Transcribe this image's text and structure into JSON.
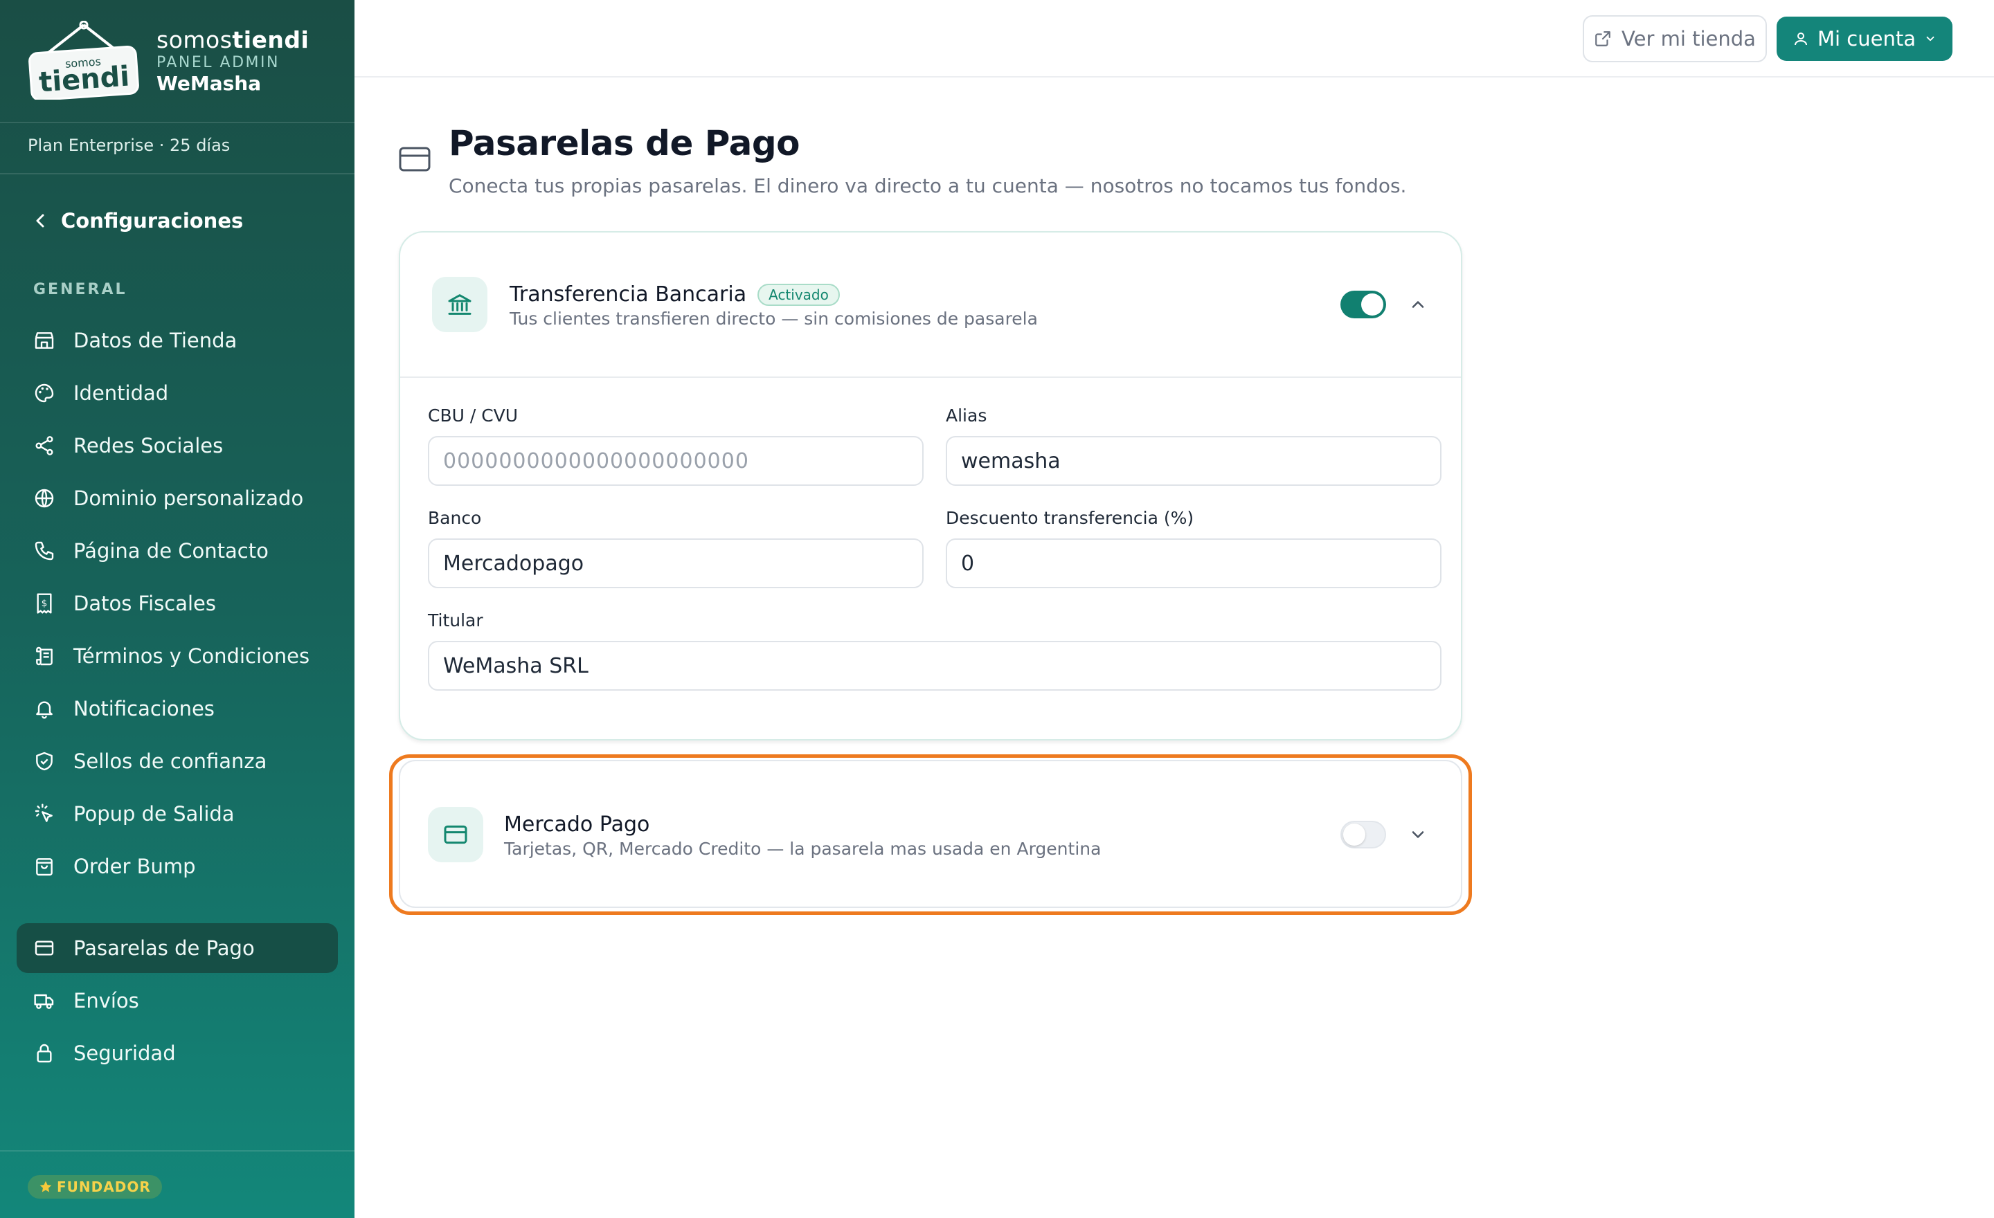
{
  "brand": {
    "logo_small": "somos",
    "logo_big": "tiendi",
    "name_light": "somos",
    "name_bold": "tiendi",
    "panel": "PANEL ADMIN",
    "store": "WeMasha"
  },
  "plan": "Plan Enterprise · 25 días",
  "sidebar": {
    "back_label": "Configuraciones",
    "section_label": "GENERAL",
    "items": [
      {
        "label": "Datos de Tienda",
        "icon": "store-icon"
      },
      {
        "label": "Identidad",
        "icon": "palette-icon"
      },
      {
        "label": "Redes Sociales",
        "icon": "share-icon"
      },
      {
        "label": "Dominio personalizado",
        "icon": "globe-icon"
      },
      {
        "label": "Página de Contacto",
        "icon": "phone-icon"
      },
      {
        "label": "Datos Fiscales",
        "icon": "receipt-icon"
      },
      {
        "label": "Términos y Condiciones",
        "icon": "scroll-icon"
      },
      {
        "label": "Notificaciones",
        "icon": "bell-icon"
      },
      {
        "label": "Sellos de confianza",
        "icon": "shield-check-icon"
      },
      {
        "label": "Popup de Salida",
        "icon": "pointer-click-icon"
      },
      {
        "label": "Order Bump",
        "icon": "bag-icon"
      }
    ],
    "items2": [
      {
        "label": "Pasarelas de Pago",
        "icon": "credit-card-icon",
        "active": true
      },
      {
        "label": "Envíos",
        "icon": "truck-icon"
      },
      {
        "label": "Seguridad",
        "icon": "lock-icon"
      }
    ],
    "badge": "FUNDADOR"
  },
  "topbar": {
    "store_button": "Ver mi tienda",
    "account_button": "Mi cuenta"
  },
  "page": {
    "title": "Pasarelas de Pago",
    "subtitle": "Conecta tus propias pasarelas. El dinero va directo a tu cuenta — nosotros no tocamos tus fondos."
  },
  "gateways": [
    {
      "name": "Transferencia Bancaria",
      "badge": "Activado",
      "description": "Tus clientes transfieren directo — sin comisiones de pasarela",
      "enabled": true,
      "expanded": true,
      "fields": {
        "cbu_label": "CBU / CVU",
        "cbu_placeholder": "0000000000000000000000",
        "alias_label": "Alias",
        "alias_value": "wemasha",
        "banco_label": "Banco",
        "banco_value": "Mercadopago",
        "descuento_label": "Descuento transferencia (%)",
        "descuento_value": "0",
        "titular_label": "Titular",
        "titular_value": "WeMasha SRL"
      }
    },
    {
      "name": "Mercado Pago",
      "description": "Tarjetas, QR, Mercado Credito — la pasarela mas usada en Argentina",
      "enabled": false,
      "expanded": false
    }
  ],
  "colors": {
    "accent": "#14857a",
    "sidebar_top": "#1a4e45",
    "sidebar_bottom": "#13877a",
    "highlight_outline": "#ee7a1f",
    "badge_green": "#13876f"
  }
}
